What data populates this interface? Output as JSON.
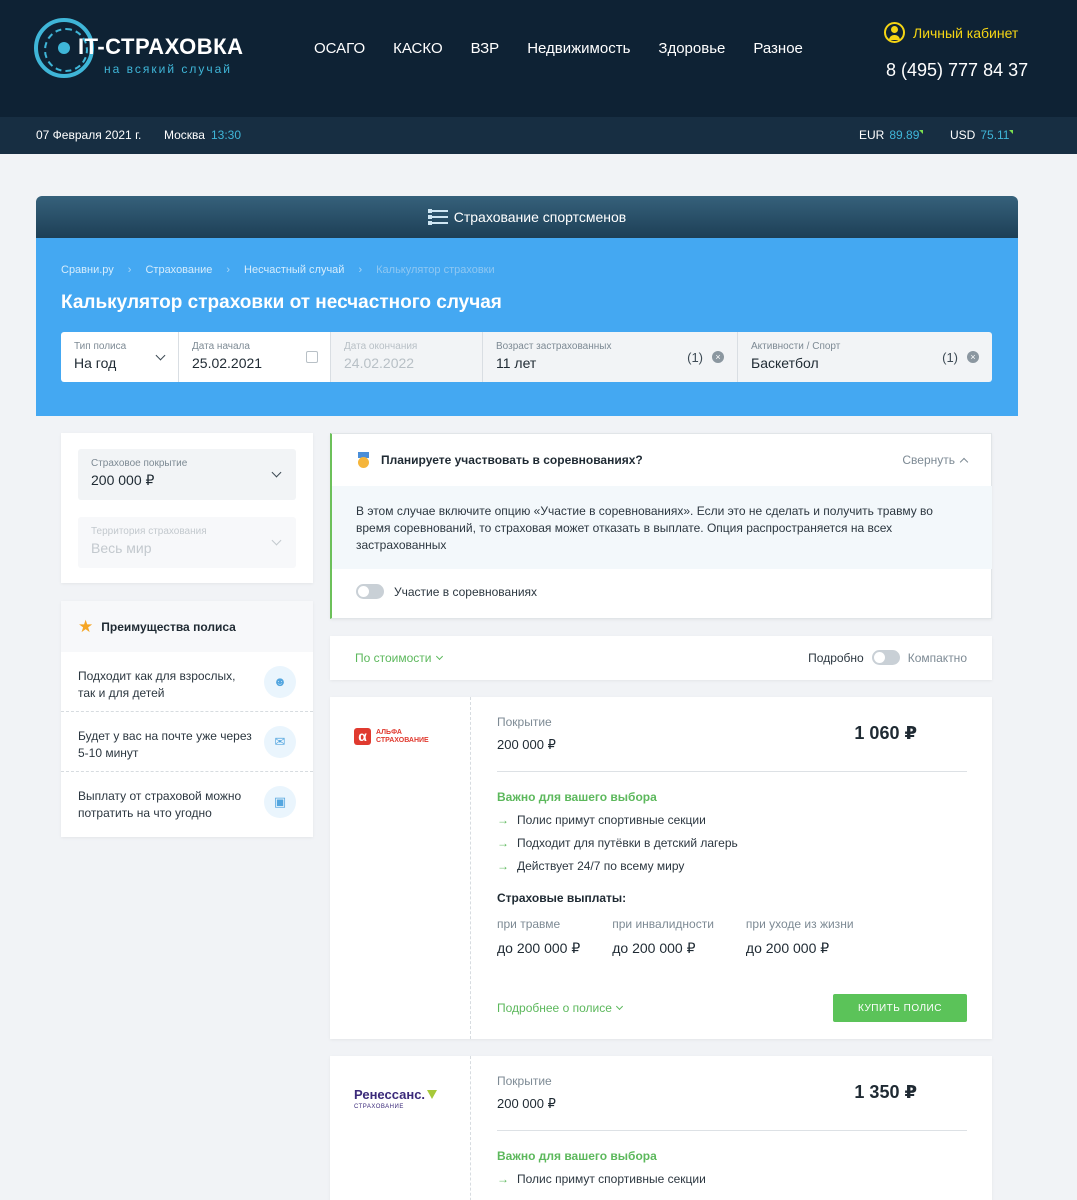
{
  "header": {
    "logo_title": "IT-СТРАХОВКА",
    "logo_subtitle": "на всякий случай",
    "nav": [
      "ОСАГО",
      "КАСКО",
      "ВЗР",
      "Недвижимость",
      "Здоровье",
      "Разное"
    ],
    "cabinet_label": "Личный кабинет",
    "phone": "8 (495) 777 84 37"
  },
  "subbar": {
    "date": "07 Февраля 2021 г.",
    "city": "Москва",
    "time": "13:30",
    "eur_label": "EUR",
    "eur_value": "89.89",
    "usd_label": "USD",
    "usd_value": "75.11"
  },
  "titlebar": {
    "label": "Страхование спортсменов"
  },
  "hero": {
    "breadcrumbs": [
      "Сравни.ру",
      "Страхование",
      "Несчастный случай",
      "Калькулятор страховки"
    ],
    "title": "Калькулятор страховки от несчастного случая",
    "filters": {
      "policy_type": {
        "label": "Тип полиса",
        "value": "На год"
      },
      "start_date": {
        "label": "Дата начала",
        "value": "25.02.2021"
      },
      "end_date": {
        "label": "Дата окончания",
        "value": "24.02.2022"
      },
      "age": {
        "label": "Возраст застрахованных",
        "value": "11 лет",
        "count": "(1)"
      },
      "sport": {
        "label": "Активности / Спорт",
        "value": "Баскетбол",
        "count": "(1)"
      }
    }
  },
  "coverage": {
    "sum": {
      "label": "Страховое покрытие",
      "value": "200 000 ₽"
    },
    "territory": {
      "label": "Территория страхования",
      "value": "Весь мир"
    }
  },
  "advantages": {
    "title": "Преимущества полиса",
    "items": [
      {
        "text": "Подходит как для взрослых, так и для детей",
        "icon": "users-icon"
      },
      {
        "text": "Будет у вас на почте уже через 5-10 минут",
        "icon": "mail-icon"
      },
      {
        "text": "Выплату от страховой можно потратить на что угодно",
        "icon": "wallet-icon"
      }
    ]
  },
  "competition": {
    "title": "Планируете участвовать в соревнованиях?",
    "collapse_label": "Свернуть",
    "text": "В этом случае включите опцию «Участие в соревнованиях». Если это не сделать и получить травму во время соревнований, то страховая может отказать в выплате. Опция распространяется на всех застрахованных",
    "toggle_label": "Участие в соревнованиях",
    "toggle_on": false
  },
  "sort_bar": {
    "sort_label": "По стоимости",
    "detailed_label": "Подробно",
    "compact_label": "Компактно"
  },
  "offers": [
    {
      "company": "Альфа Страхование",
      "logo_line1": "АЛЬФА",
      "logo_line2": "СТРАХОВАНИЕ",
      "coverage_label": "Покрытие",
      "coverage_value": "200 000 ₽",
      "price": "1 060 ₽",
      "important_title": "Важно для вашего выбора",
      "features": [
        "Полис примут спортивные секции",
        "Подходит для путёвки в детский лагерь",
        "Действует 24/7 по всему миру"
      ],
      "payouts_title": "Страховые выплаты:",
      "payouts": [
        {
          "label": "при травме",
          "value": "до 200 000 ₽"
        },
        {
          "label": "при инвалидности",
          "value": "до 200 000 ₽"
        },
        {
          "label": "при уходе из жизни",
          "value": "до 200 000 ₽"
        }
      ],
      "more_label": "Подробнее о полисе",
      "buy_label": "КУПИТЬ ПОЛИС"
    },
    {
      "company": "Ренессанс Страхование",
      "logo_name": "Ренессанс.",
      "logo_sub": "СТРАХОВАНИЕ",
      "coverage_label": "Покрытие",
      "coverage_value": "200 000 ₽",
      "price": "1 350 ₽",
      "important_title": "Важно для вашего выбора",
      "features": [
        "Полис примут спортивные секции"
      ]
    }
  ],
  "colors": {
    "header_bg": "#0e2234",
    "accent_blue": "#44a8f2",
    "accent_green": "#5bc359",
    "cabinet_yellow": "#f5d514"
  }
}
